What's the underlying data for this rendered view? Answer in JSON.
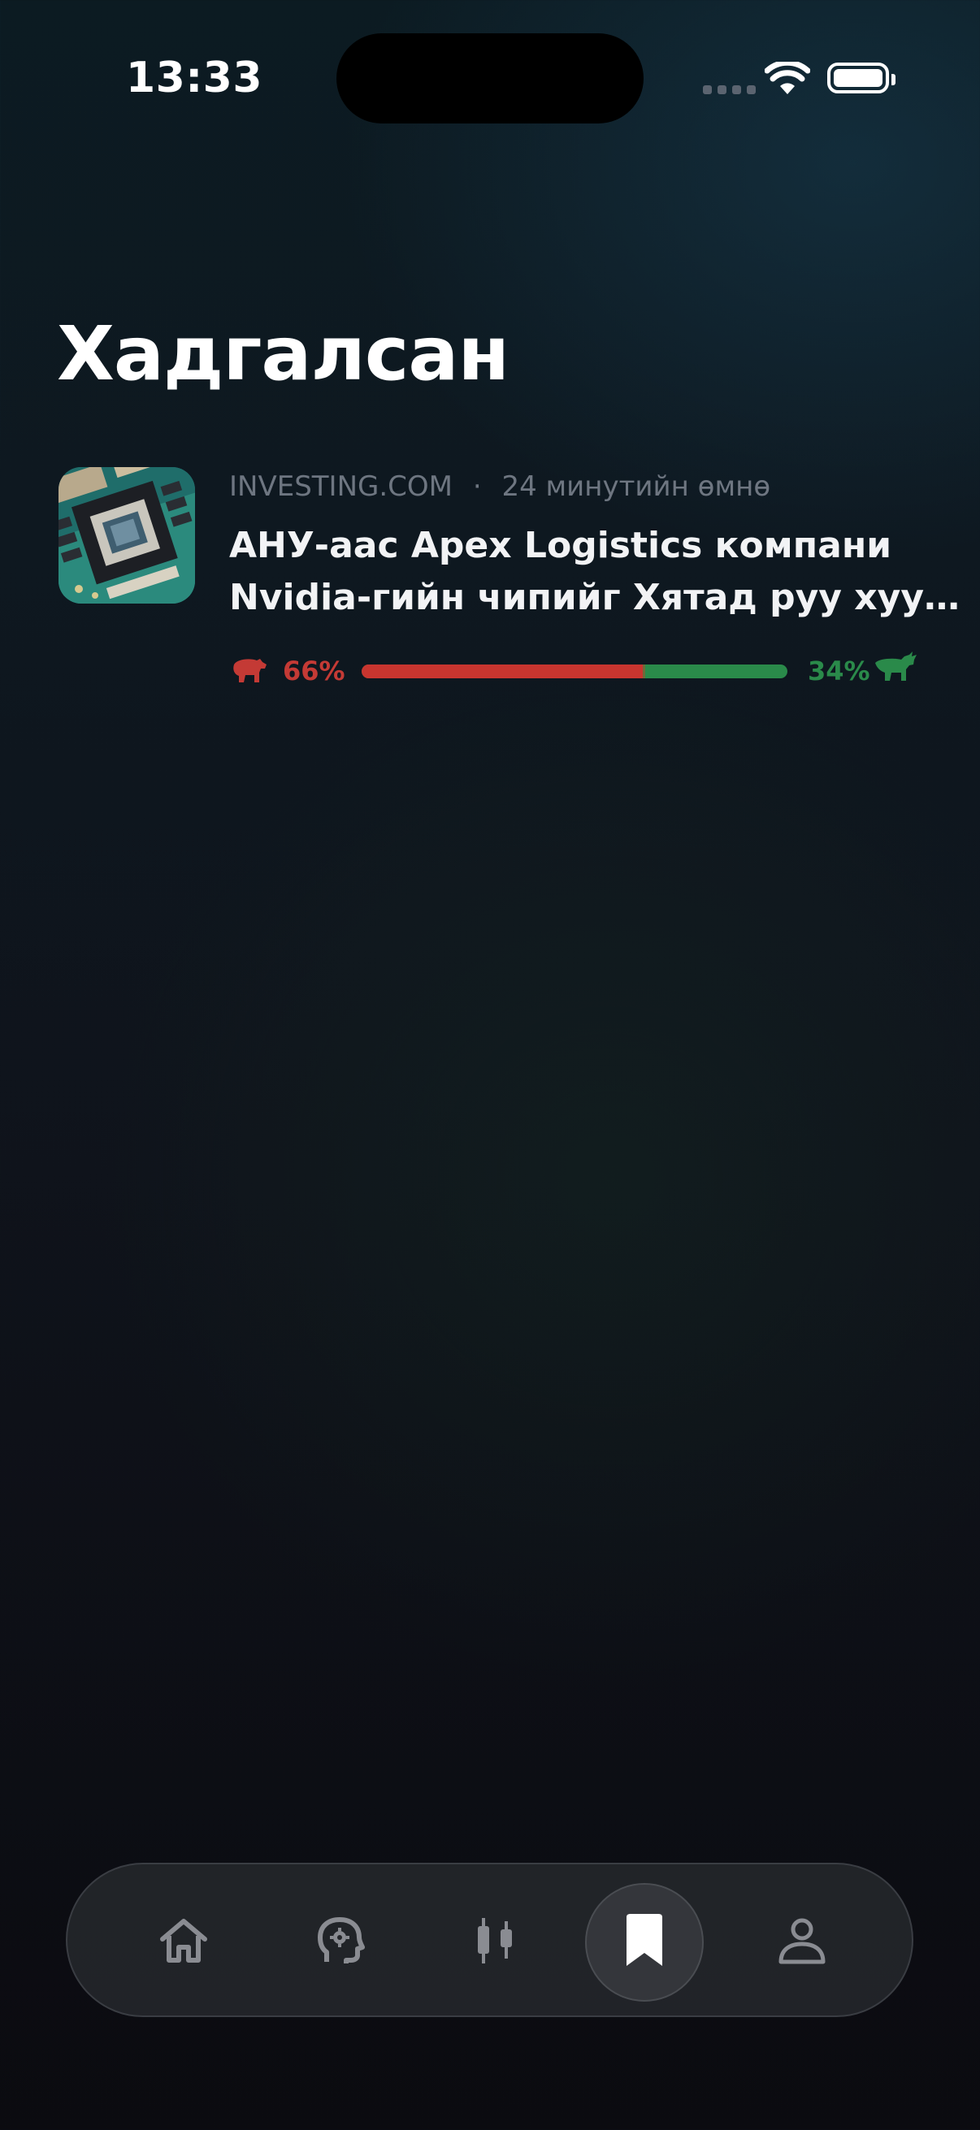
{
  "status_bar": {
    "time": "13:33"
  },
  "page": {
    "title": "Хадгалсан"
  },
  "saved_articles": [
    {
      "source": "INVESTING.COM",
      "separator": "·",
      "time_ago": "24 минутийн өмнө",
      "headline_line1": "АНУ-аас Apex Logistics компани",
      "headline_line2": "Nvidia-гийн чипийг Хятад руу хууль...",
      "thumbnail": "gpu-chip-image",
      "sentiment": {
        "bearish_pct": 66,
        "bearish_label": "66%",
        "bullish_pct": 34,
        "bullish_label": "34%",
        "bearish_color": "#c8352f",
        "bullish_color": "#2a8a4a"
      }
    }
  ],
  "tab_bar": {
    "active": "saved",
    "tabs": [
      {
        "id": "home",
        "icon": "home-icon"
      },
      {
        "id": "ai",
        "icon": "head-gear-icon"
      },
      {
        "id": "market",
        "icon": "candlestick-icon"
      },
      {
        "id": "saved",
        "icon": "bookmark-icon"
      },
      {
        "id": "profile",
        "icon": "person-icon"
      }
    ]
  }
}
